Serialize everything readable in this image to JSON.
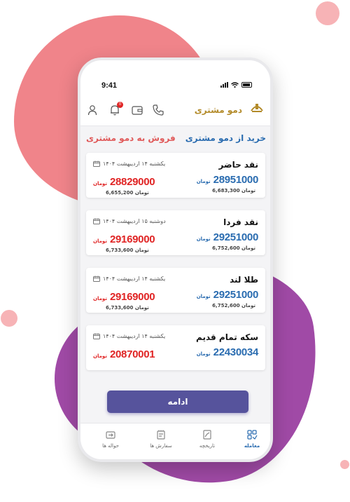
{
  "status_bar": {
    "time": "9:41"
  },
  "header": {
    "brand": "دمو مشتری",
    "notification_count": "0"
  },
  "sections": {
    "buy_title": "خرید از دمو مشتری",
    "sell_title": "فروش به دمو مشتری"
  },
  "items": [
    {
      "title": "نقد حاضر",
      "date": "یکشنبه ۱۴ اردیبهشت ۱۴۰۴",
      "buy_price": "28951000",
      "buy_unit": "تومان",
      "buy_sub": "6,683,300 تومان",
      "sell_price": "28829000",
      "sell_unit": "تومان",
      "sell_sub": "6,655,200 تومان"
    },
    {
      "title": "نقد فردا",
      "date": "دوشنبه ۱۵ اردیبهشت ۱۴۰۴",
      "buy_price": "29251000",
      "buy_unit": "تومان",
      "buy_sub": "6,752,600 تومان",
      "sell_price": "29169000",
      "sell_unit": "تومان",
      "sell_sub": "6,733,600 تومان"
    },
    {
      "title": "طلا لند",
      "date": "یکشنبه ۱۴ اردیبهشت ۱۴۰۴",
      "buy_price": "29251000",
      "buy_unit": "تومان",
      "buy_sub": "6,752,600 تومان",
      "sell_price": "29169000",
      "sell_unit": "تومان",
      "sell_sub": "6,733,600 تومان"
    },
    {
      "title": "سکه تمام قدیم",
      "date": "یکشنبه ۱۴ اردیبهشت ۱۴۰۴",
      "buy_price": "22430034",
      "buy_unit": "تومان",
      "sell_price": "20870001",
      "sell_unit": "تومان"
    }
  ],
  "cta_label": "ادامه",
  "nav": [
    {
      "label": "معامله",
      "icon": "trade-icon",
      "active": true
    },
    {
      "label": "تاریخچه",
      "icon": "history-icon",
      "active": false
    },
    {
      "label": "سفارش ها",
      "icon": "orders-icon",
      "active": false
    },
    {
      "label": "حواله ها",
      "icon": "remittance-icon",
      "active": false
    }
  ],
  "colors": {
    "buy": "#2a6cb0",
    "sell": "#e02424",
    "sell_heading": "#e05a5a",
    "brand_gold": "#b38b2a",
    "cta": "#56539c",
    "blob_pink": "#f0848a",
    "blob_purple": "#a04aa6"
  }
}
